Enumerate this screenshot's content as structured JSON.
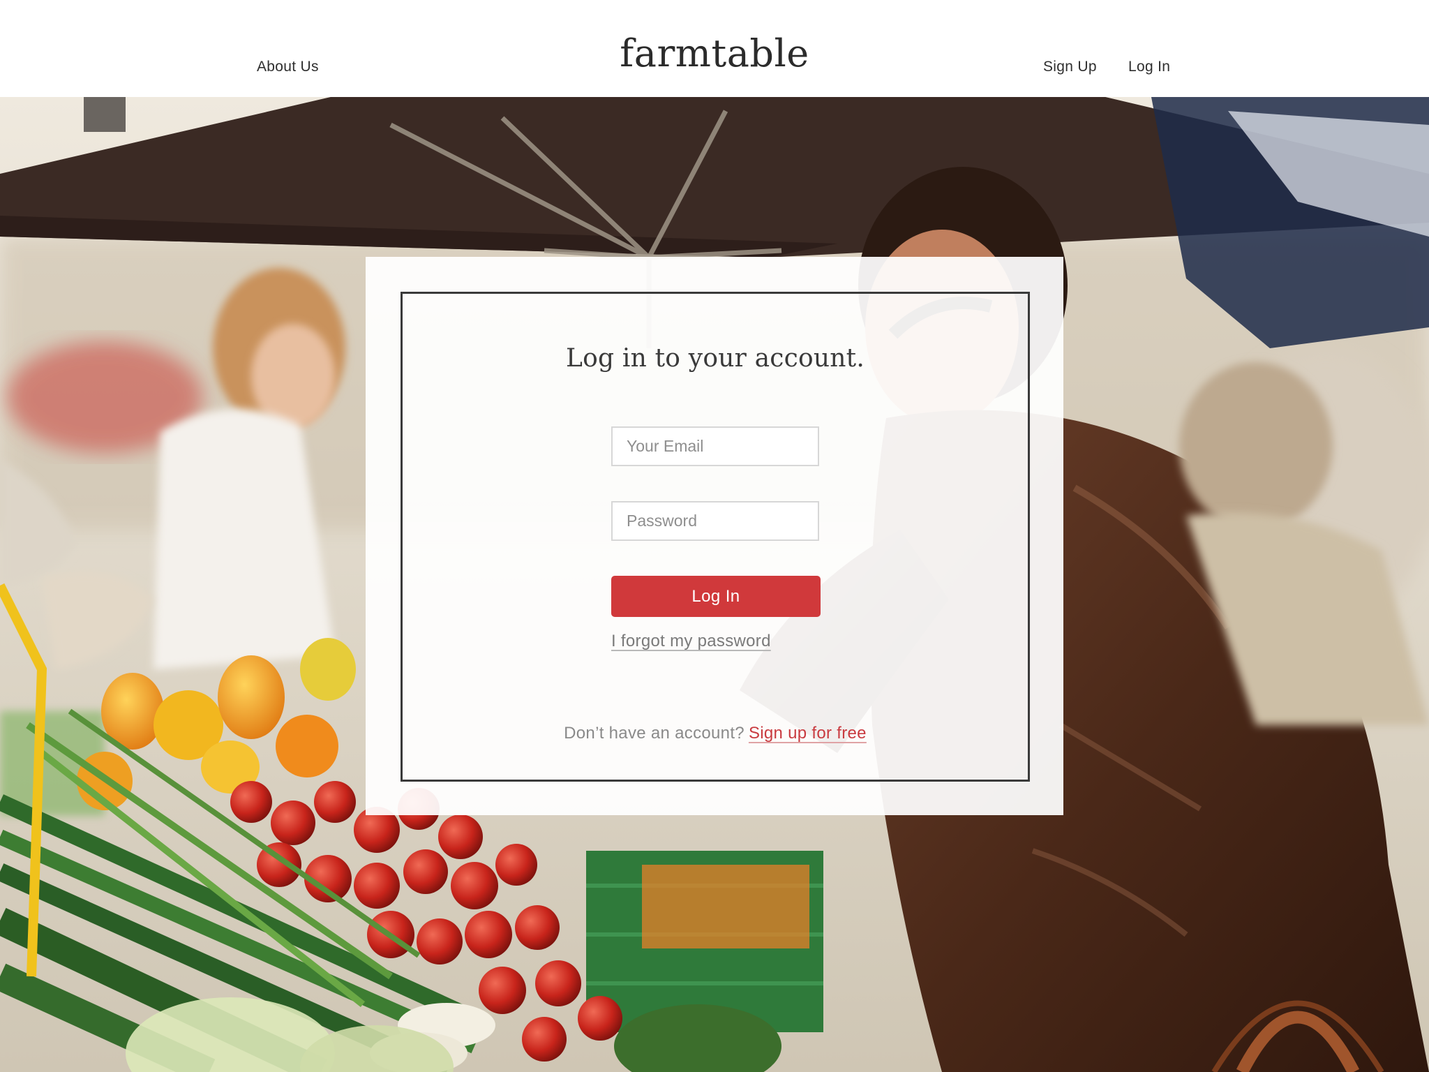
{
  "header": {
    "logo": "farmtable",
    "nav_left": {
      "about": "About Us"
    },
    "nav_right": {
      "signup": "Sign Up",
      "login": "Log In"
    }
  },
  "login_card": {
    "title": "Log in to your account.",
    "email_placeholder": "Your Email",
    "password_placeholder": "Password",
    "submit_label": "Log In",
    "forgot_password": "I forgot my password",
    "no_account_text": "Don’t have an account?",
    "signup_link": "Sign up for free"
  },
  "colors": {
    "accent": "#d0393b",
    "link_red": "#c93b40",
    "text_dark": "#2f2f2f",
    "card_border": "#3a3a3a"
  }
}
